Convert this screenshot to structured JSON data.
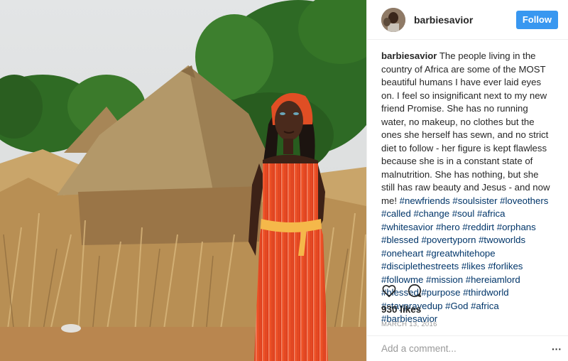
{
  "post": {
    "username": "barbiesavior",
    "follow_label": "Follow",
    "caption_username": "barbiesavior",
    "caption_text": "The people living in the country of Africa are some of the MOST beautiful humans I have ever laid eyes on. I feel so insignificant next to my new friend Promise. She has no running water, no makeup, no clothes but the ones she herself has sewn, and no strict diet to follow - her figure is kept flawless because she is in a constant state of malnutrition. She has nothing, but she still has raw beauty and Jesus - and now me!",
    "hashtags": "#newfriends #soulsister #loveothers #called #change #soul #africa #whitesavior #hero #reddirt #orphans #blessed #povertyporn #twoworlds #oneheart #greatwhitehope #disciplethestreets #likes #forlikes #followme #mission #hereiamlord #blessed #purpose #thirdworld #stayprayedup #God #africa #barbiesavior",
    "likes": "930 likes",
    "date": "MARCH 13, 2016",
    "comment_placeholder": "Add a comment...",
    "more_label": "···"
  },
  "icons": {
    "like": "heart-icon",
    "comment": "comment-bubble-icon",
    "more": "more-options-icon"
  },
  "colors": {
    "follow_bg": "#3897f0",
    "hashtag": "#003569",
    "text": "#262626",
    "muted": "#999999"
  }
}
